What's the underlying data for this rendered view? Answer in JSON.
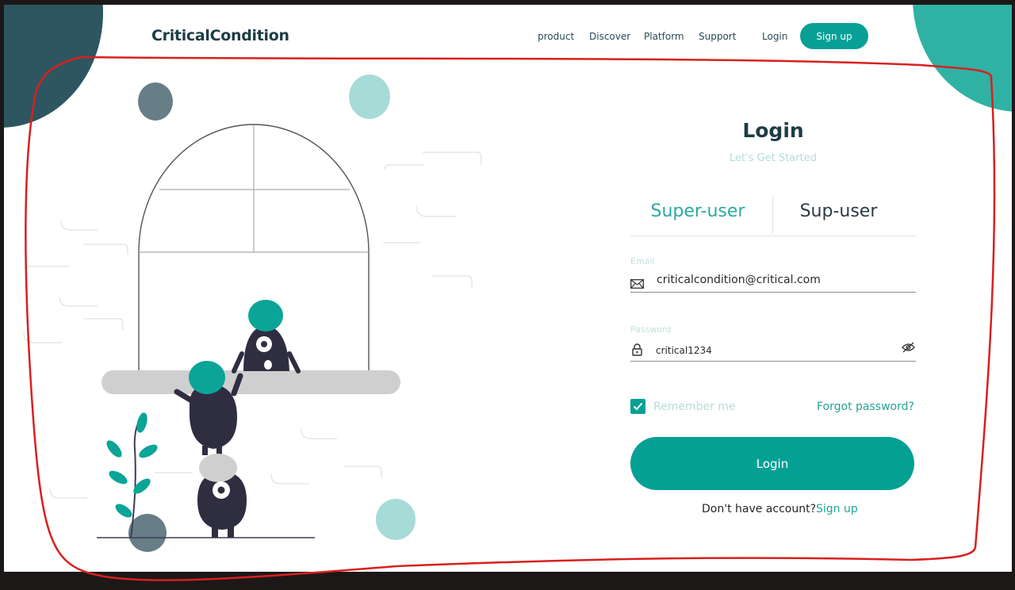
{
  "header": {
    "logo": "CriticalCondition",
    "nav": [
      "product",
      "Discover",
      "Platform",
      "Support",
      "Login"
    ],
    "signup_button": "Sign up"
  },
  "login_form": {
    "title": "Login",
    "subtitle": "Let's Get Started",
    "tabs": [
      {
        "label": "Super-user",
        "active": true
      },
      {
        "label": "Sup-user",
        "active": false
      }
    ],
    "email": {
      "label": "Email",
      "value": "criticalcondition@critical.com",
      "icon": "mail-icon"
    },
    "password": {
      "label": "Password",
      "value": "critical1234",
      "icon": "lock-icon",
      "toggle_icon": "eye-slash-icon"
    },
    "remember_me": {
      "label": "Remember me",
      "checked": true
    },
    "forgot_password": "Forgot password?",
    "submit_button": "Login",
    "no_account_text": "Don't have account?",
    "signup_link": "Sign up"
  },
  "colors": {
    "accent": "#08a096",
    "dark_teal": "#2d5660",
    "heading": "#1d3c46",
    "annotation": "#d8201f"
  }
}
